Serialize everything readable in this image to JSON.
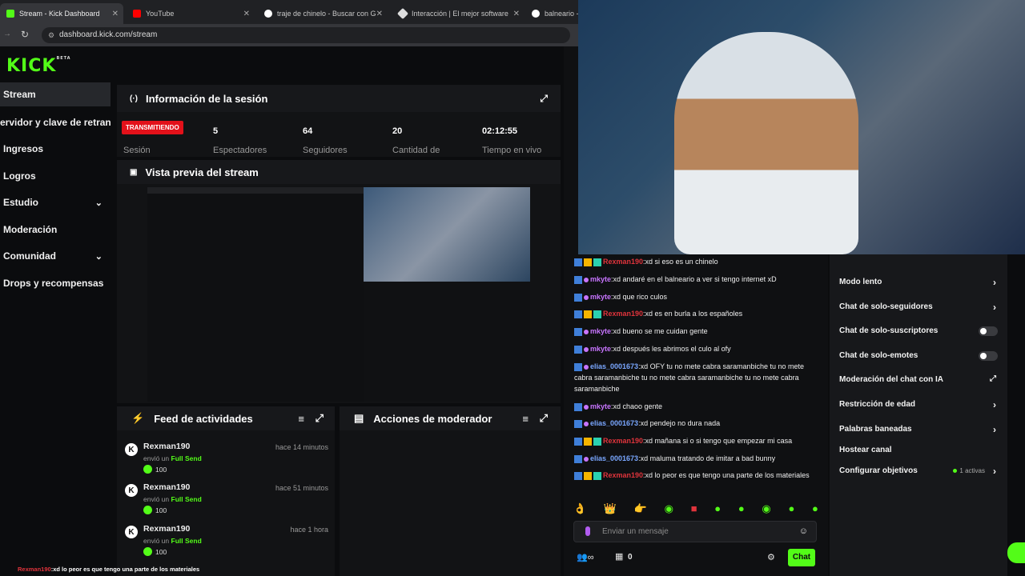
{
  "browser": {
    "tabs": [
      {
        "title": "Stream - Kick Dashboard",
        "icon": "kick-icon"
      },
      {
        "title": "YouTube",
        "icon": "youtube-icon"
      },
      {
        "title": "traje de chinelo - Buscar con G",
        "icon": "google-icon"
      },
      {
        "title": "Interacción | El mejor software",
        "icon": "interaction-icon"
      },
      {
        "title": "balneario -",
        "icon": "google-icon"
      }
    ],
    "url": "dashboard.kick.com/stream"
  },
  "sidebar": {
    "logo": "KICK",
    "logo_sup": "BETA",
    "items": [
      {
        "label": "Stream"
      },
      {
        "label": "ervidor y clave de retransn"
      },
      {
        "label": "Ingresos"
      },
      {
        "label": "Logros"
      },
      {
        "label": "Estudio"
      },
      {
        "label": "Moderación"
      },
      {
        "label": "Comunidad"
      },
      {
        "label": "Drops y recompensas"
      }
    ]
  },
  "session": {
    "title": "Información de la sesión",
    "badge": "TRANSMITIENDO",
    "session_label": "Sesión",
    "stats": [
      {
        "value": "5",
        "label": "Espectadores"
      },
      {
        "value": "64",
        "label": "Seguidores"
      },
      {
        "value": "20",
        "label": "Cantidad de"
      },
      {
        "value": "02:12:55",
        "label": "Tiempo en vivo"
      }
    ]
  },
  "preview": {
    "title": "Vista previa del stream"
  },
  "feed": {
    "title": "Feed de actividades",
    "items": [
      {
        "user": "Rexman190",
        "time": "hace 14 minutos",
        "sent": "envió un",
        "item": "Full Send",
        "amount": "100"
      },
      {
        "user": "Rexman190",
        "time": "hace 51 minutos",
        "sent": "envió un",
        "item": "Full Send",
        "amount": "100"
      },
      {
        "user": "Rexman190",
        "time": "hace 1 hora",
        "sent": "envió un",
        "item": "Full Send",
        "amount": "100"
      }
    ]
  },
  "modactions": {
    "title": "Acciones de moderador"
  },
  "chat": {
    "messages": [
      {
        "user": "Rexman190",
        "color": "#e0343c",
        "text": ":xd si eso es un chinelo"
      },
      {
        "user": "mkyte",
        "color": "#c875ff",
        "text": ":xd andaré en el balneario a ver si tengo internet xD"
      },
      {
        "user": "mkyte",
        "color": "#c875ff",
        "text": ":xd que rico culos"
      },
      {
        "user": "Rexman190",
        "color": "#e0343c",
        "text": ":xd es en burla a los españoles"
      },
      {
        "user": "mkyte",
        "color": "#c875ff",
        "text": ":xd bueno se me cuidan gente"
      },
      {
        "user": "mkyte",
        "color": "#c875ff",
        "text": ":xd después les abrimos el culo al ofy"
      },
      {
        "user": "elias_0001673",
        "color": "#7aa7ff",
        "text": ":xd OFY tu no mete cabra saramanbiche tu no mete cabra saramanbiche tu no mete cabra saramanbiche tu no mete cabra saramanbiche"
      },
      {
        "user": "mkyte",
        "color": "#c875ff",
        "text": ":xd chaoo gente"
      },
      {
        "user": "elias_0001673",
        "color": "#7aa7ff",
        "text": ":xd pendejo no dura nada"
      },
      {
        "user": "Rexman190",
        "color": "#e0343c",
        "text": ":xd mañana si o si tengo que empezar mi casa"
      },
      {
        "user": "elias_0001673",
        "color": "#7aa7ff",
        "text": ":xd maluma tratando de imitar a bad bunny"
      },
      {
        "user": "Rexman190",
        "color": "#e0343c",
        "text": ":xd lo peor es que tengo una parte de los materiales"
      }
    ],
    "input_placeholder": "Enviar un mensaje",
    "count": "0",
    "send_label": "Chat",
    "ticker": ":xd lo peor es que tengo una parte de los materiales",
    "ticker_user": "Rexman190"
  },
  "settings": {
    "items": [
      {
        "label": "Modo lento",
        "control": "arrow"
      },
      {
        "label": "Chat de solo-seguidores",
        "control": "arrow"
      },
      {
        "label": "Chat de solo-suscriptores",
        "control": "toggle"
      },
      {
        "label": "Chat de solo-emotes",
        "control": "toggle"
      },
      {
        "label": "Moderación del chat con IA",
        "control": "external"
      },
      {
        "label": "Restricción de edad",
        "control": "arrow"
      },
      {
        "label": "Palabras baneadas",
        "control": "arrow"
      },
      {
        "label": "Hostear canal",
        "control": "none"
      },
      {
        "label": "Configurar objetivos",
        "control": "arrow",
        "extra": "1 activas"
      }
    ]
  },
  "colors": {
    "accent": "#53fc18",
    "live": "#e3111a"
  }
}
